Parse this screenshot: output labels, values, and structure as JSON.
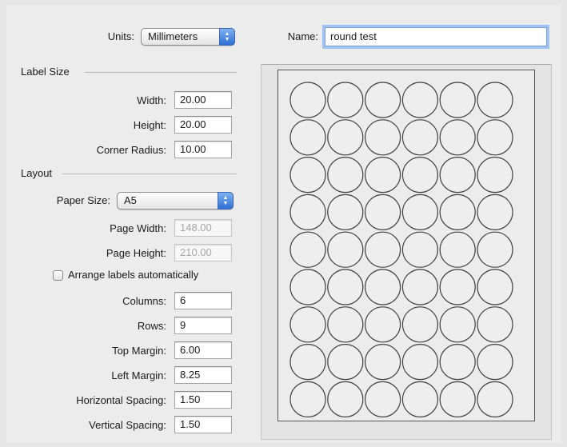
{
  "units": {
    "label": "Units:",
    "value": "Millimeters"
  },
  "name": {
    "label": "Name:",
    "value": "round test"
  },
  "label_size": {
    "title": "Label Size",
    "width": {
      "label": "Width:",
      "value": "20.00"
    },
    "height": {
      "label": "Height:",
      "value": "20.00"
    },
    "corner_radius": {
      "label": "Corner Radius:",
      "value": "10.00"
    }
  },
  "layout": {
    "title": "Layout",
    "paper_size": {
      "label": "Paper Size:",
      "value": "A5"
    },
    "page_width": {
      "label": "Page Width:",
      "value": "148.00"
    },
    "page_height": {
      "label": "Page Height:",
      "value": "210.00"
    },
    "arrange_auto": {
      "label": "Arrange labels automatically",
      "checked": false
    },
    "columns": {
      "label": "Columns:",
      "value": "6"
    },
    "rows": {
      "label": "Rows:",
      "value": "9"
    },
    "top_margin": {
      "label": "Top Margin:",
      "value": "6.00"
    },
    "left_margin": {
      "label": "Left Margin:",
      "value": "8.25"
    },
    "horizontal_spacing": {
      "label": "Horizontal Spacing:",
      "value": "1.50"
    },
    "vertical_spacing": {
      "label": "Vertical Spacing:",
      "value": "1.50"
    }
  },
  "preview": {
    "columns": 6,
    "rows": 9
  },
  "colors": {
    "accent": "#3b7be0",
    "focus_ring": "#9ec2f2"
  }
}
